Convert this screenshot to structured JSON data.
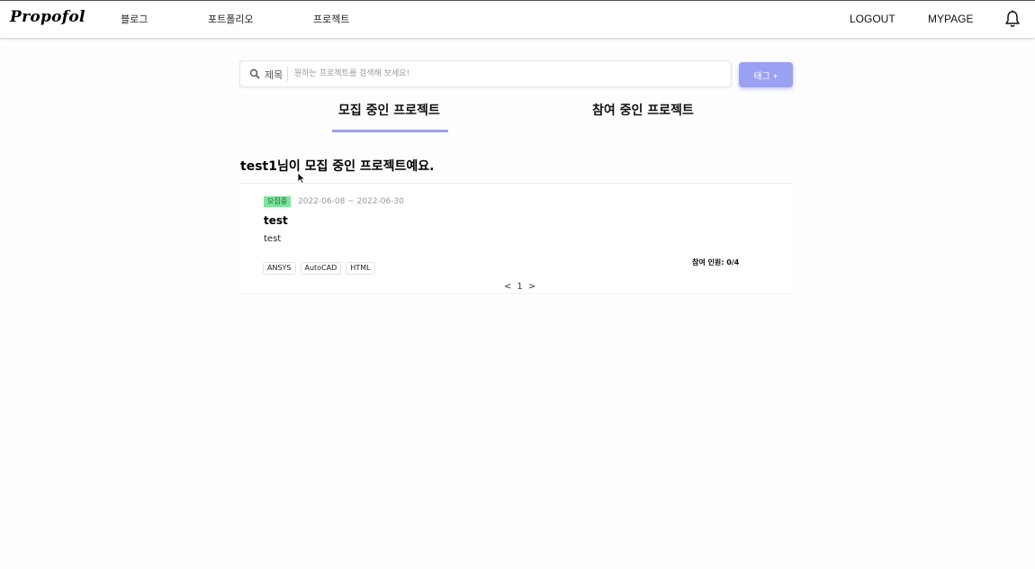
{
  "header": {
    "logo": "Propofol",
    "nav": [
      "블로그",
      "포트폴리오",
      "프로젝트"
    ],
    "logout": "LOGOUT",
    "mypage": "MYPAGE"
  },
  "search": {
    "label": "제목",
    "placeholder": "원하는 프로젝트를 검색해 보세요!",
    "tag_button": "태그 +"
  },
  "tabs": {
    "recruiting": "모집 중인 프로젝트",
    "participating": "참여 중인 프로젝트",
    "active": "recruiting",
    "accent": "#9aa1e6"
  },
  "section_title": "test1님이 모집 중인 프로젝트예요.",
  "project": {
    "status": "모집중",
    "period": "2022-06-08 ~ 2022-06-30",
    "title": "test",
    "description": "test",
    "tags": [
      "ANSYS",
      "AutoCAD",
      "HTML"
    ],
    "participants": "참여 인원: 0/4"
  },
  "pagination": {
    "prev": "<",
    "current": "1",
    "next": ">"
  },
  "colors": {
    "status_badge": "#7ee39c",
    "tag_button": "#9aa1f3"
  }
}
